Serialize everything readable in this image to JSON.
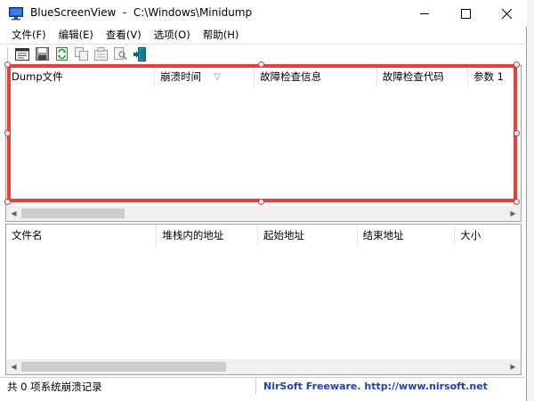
{
  "window": {
    "title": "BlueScreenView  -  C:\\Windows\\Minidump"
  },
  "menu": [
    {
      "label": "文件(F)"
    },
    {
      "label": "编辑(E)"
    },
    {
      "label": "查看(V)"
    },
    {
      "label": "选项(O)"
    },
    {
      "label": "帮助(H)"
    }
  ],
  "toolbar": {
    "icons": [
      "open-report-icon",
      "save-icon",
      "refresh-icon",
      "copy-icon",
      "properties-icon",
      "find-icon",
      "exit-icon"
    ]
  },
  "crash_list": {
    "columns": [
      {
        "label": "Dump文件"
      },
      {
        "label": "崩溃时间",
        "sorted": true
      },
      {
        "label": "故障检查信息"
      },
      {
        "label": "故障检查代码"
      },
      {
        "label": "参数 1"
      }
    ],
    "rows": []
  },
  "driver_list": {
    "columns": [
      {
        "label": "文件名"
      },
      {
        "label": "堆栈内的地址"
      },
      {
        "label": "起始地址"
      },
      {
        "label": "结束地址"
      },
      {
        "label": "大小"
      }
    ],
    "rows": []
  },
  "status": {
    "left": "共 0 项系统崩溃记录",
    "right": "NirSoft Freeware.  http://www.nirsoft.net"
  },
  "colors": {
    "highlight": "#f03b3b",
    "link": "#1a3fc4"
  }
}
